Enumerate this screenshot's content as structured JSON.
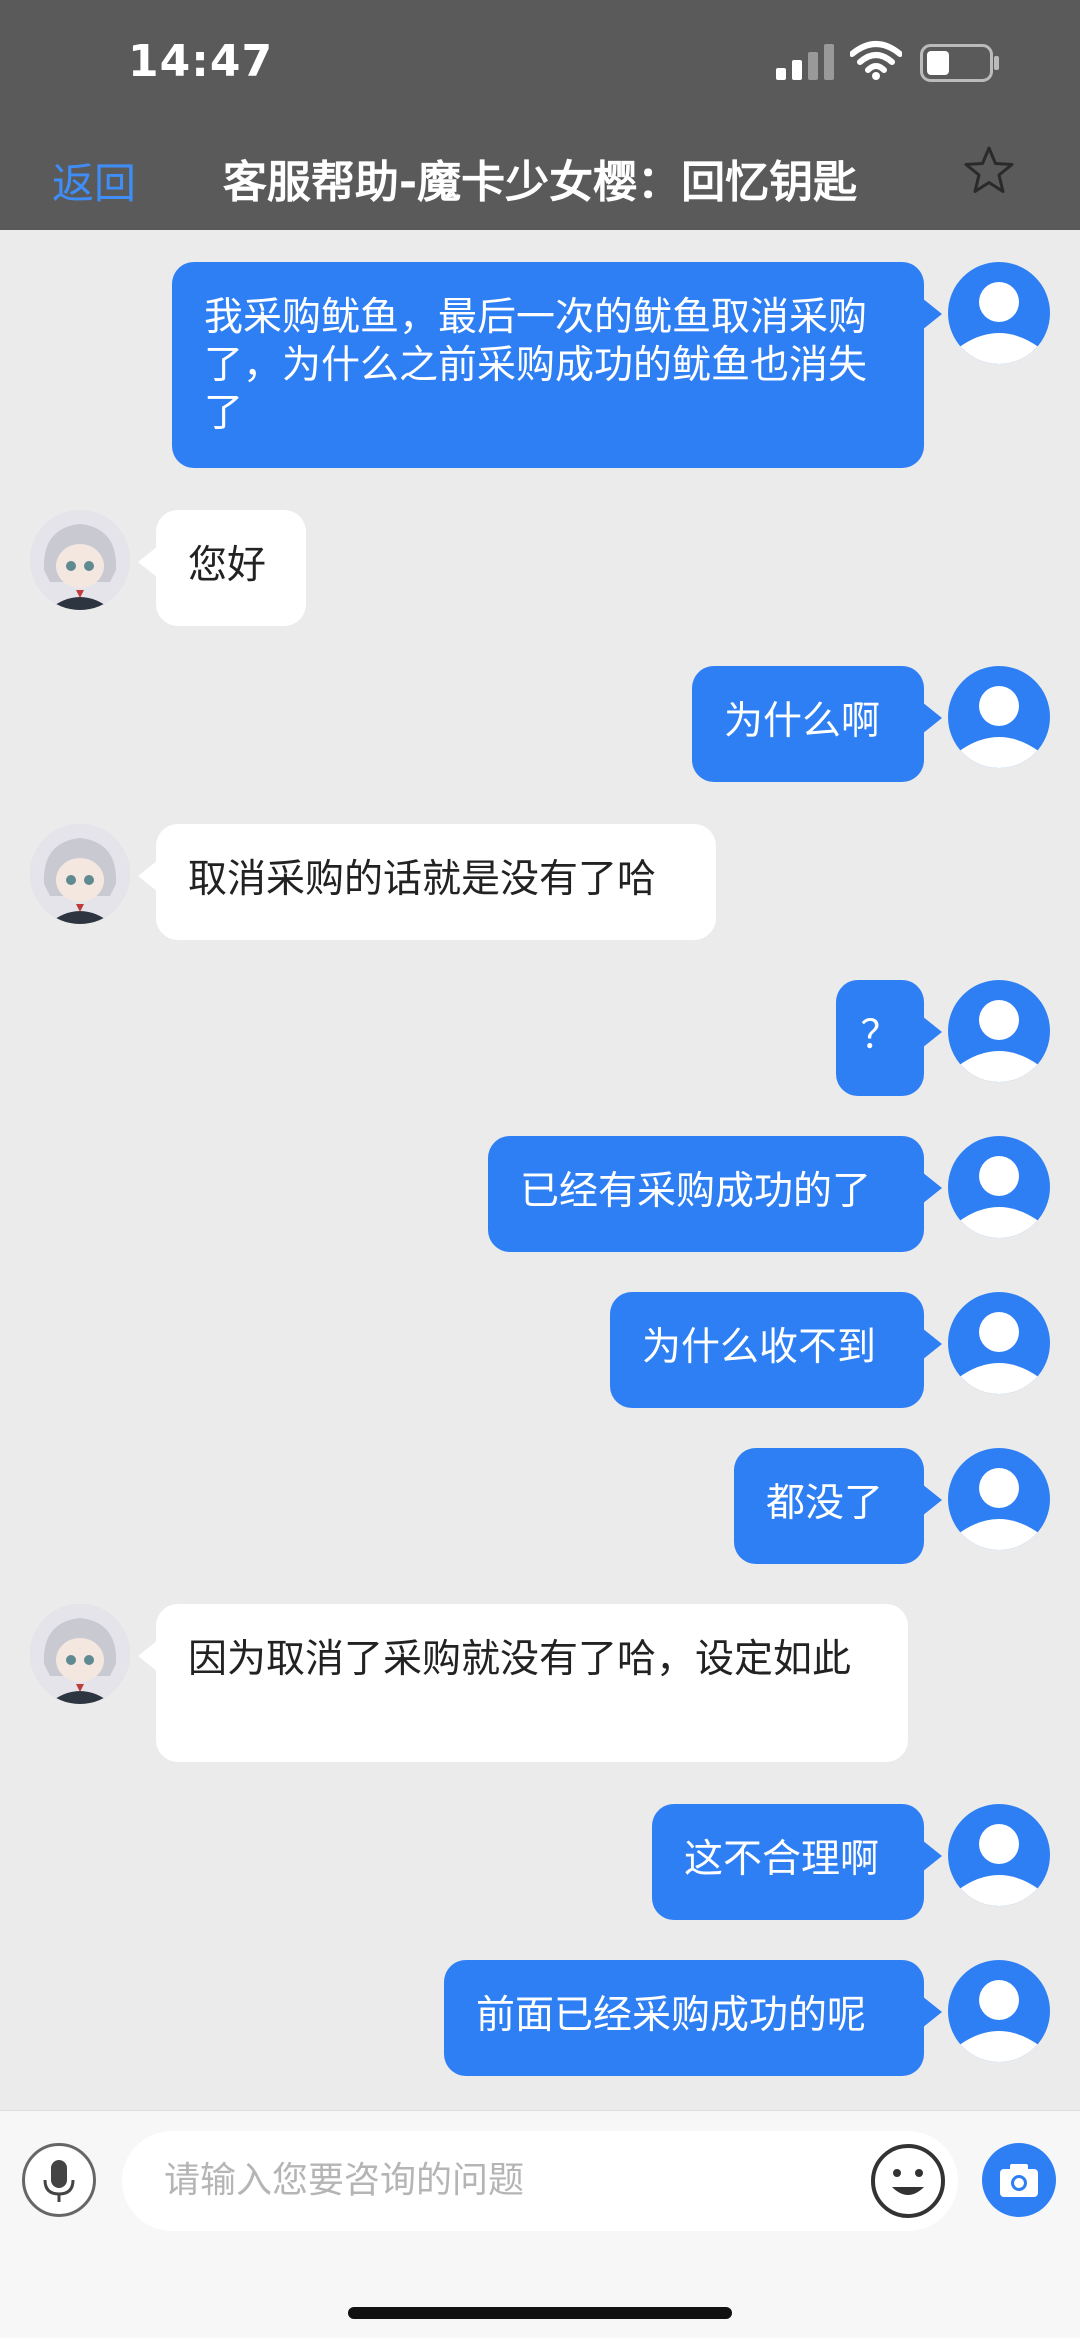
{
  "status": {
    "time": "14:47"
  },
  "header": {
    "back_label": "返回",
    "title": "客服帮助-魔卡少女樱：回忆钥匙"
  },
  "messages": [
    {
      "from": "me",
      "text": "我采购鱿鱼，最后一次的鱿鱼取消采购了，为什么之前采购成功的鱿鱼也消失了"
    },
    {
      "from": "them",
      "text": "您好"
    },
    {
      "from": "me",
      "text": "为什么啊"
    },
    {
      "from": "them",
      "text": "取消采购的话就是没有了哈"
    },
    {
      "from": "me",
      "text": "？"
    },
    {
      "from": "me",
      "text": "已经有采购成功的了"
    },
    {
      "from": "me",
      "text": "为什么收不到"
    },
    {
      "from": "me",
      "text": "都没了"
    },
    {
      "from": "them",
      "text": "因为取消了采购就没有了哈，设定如此"
    },
    {
      "from": "me",
      "text": "这不合理啊"
    },
    {
      "from": "me",
      "text": "前面已经采购成功的呢"
    }
  ],
  "input": {
    "placeholder": "请输入您要咨询的问题"
  },
  "colors": {
    "accent": "#2f7ff4",
    "header_bg": "#5a5a5a",
    "chat_bg": "#ebebeb"
  },
  "icons": [
    "signal-icon",
    "wifi-icon",
    "battery-icon",
    "star-icon",
    "user-avatar-icon",
    "agent-avatar",
    "microphone-icon",
    "emoji-icon",
    "camera-icon"
  ]
}
